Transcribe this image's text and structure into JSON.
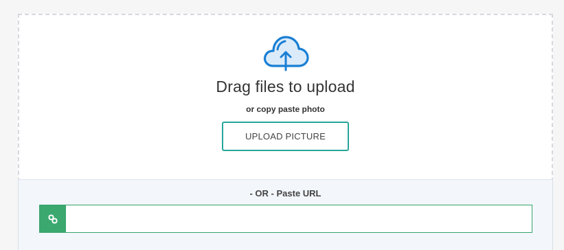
{
  "upload": {
    "icon": "cloud-upload-icon",
    "title": "Drag files to upload",
    "subtitle": "or copy paste photo",
    "button_label": "UPLOAD PICTURE"
  },
  "url_section": {
    "label": "- OR - Paste URL",
    "icon": "link-icon",
    "input_value": "",
    "input_placeholder": ""
  },
  "colors": {
    "accent_teal": "#26a59a",
    "link_green": "#3aa86f",
    "cloud_blue": "#1a7fd4",
    "cloud_fill": "#dcebfa"
  }
}
